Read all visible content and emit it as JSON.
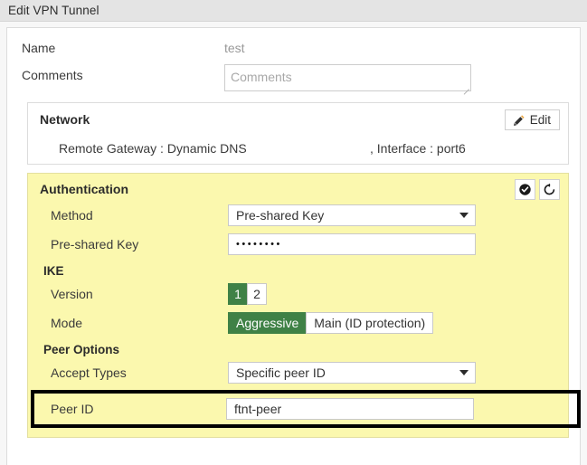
{
  "window": {
    "title": "Edit VPN Tunnel"
  },
  "form": {
    "name_label": "Name",
    "name_value": "test",
    "comments_label": "Comments",
    "comments_value": "",
    "comments_placeholder": "Comments"
  },
  "network": {
    "title": "Network",
    "edit_label": "Edit",
    "edit_icon": "pencil-icon",
    "remote_gateway": "Remote Gateway : Dynamic DNS",
    "interface": ", Interface : port6"
  },
  "authentication": {
    "title": "Authentication",
    "apply_icon": "check-circle-icon",
    "revert_icon": "revert-arrow-icon",
    "method": {
      "label": "Method",
      "value": "Pre-shared Key"
    },
    "preshared_key": {
      "label": "Pre-shared Key",
      "value": "••••••••"
    },
    "ike": {
      "heading": "IKE",
      "version": {
        "label": "Version",
        "options": [
          "1",
          "2"
        ],
        "selected": "1"
      },
      "mode": {
        "label": "Mode",
        "options": [
          "Aggressive",
          "Main (ID protection)"
        ],
        "selected": "Aggressive"
      }
    },
    "peer_options": {
      "heading": "Peer Options",
      "accept_types": {
        "label": "Accept Types",
        "value": "Specific peer ID"
      },
      "peer_id": {
        "label": "Peer ID",
        "value": "ftnt-peer"
      }
    }
  },
  "colors": {
    "selected_toggle": "#3f8146",
    "section_highlight": "#fbf8ae",
    "titlebar": "#e4e4e4",
    "highlight_box": "#000000"
  }
}
